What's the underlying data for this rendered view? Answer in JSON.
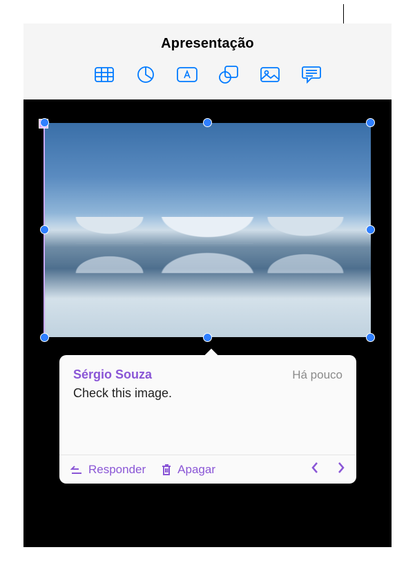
{
  "header": {
    "title": "Apresentação"
  },
  "toolbar": {
    "items": [
      {
        "name": "table-icon"
      },
      {
        "name": "chart-icon"
      },
      {
        "name": "text-icon"
      },
      {
        "name": "shape-icon"
      },
      {
        "name": "media-icon"
      },
      {
        "name": "comment-icon"
      }
    ]
  },
  "comment": {
    "author": "Sérgio Souza",
    "time": "Há pouco",
    "text": "Check this image."
  },
  "actions": {
    "reply": "Responder",
    "delete": "Apagar"
  },
  "colors": {
    "accent": "#007aff",
    "comment_accent": "#8a56d6",
    "selection_handle": "#2f7fff"
  }
}
